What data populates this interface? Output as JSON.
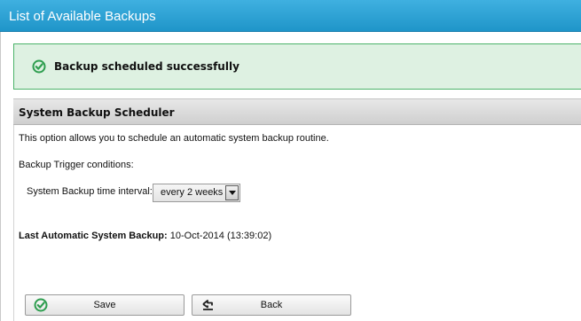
{
  "header": {
    "title": "List of Available Backups"
  },
  "alert": {
    "message": "Backup scheduled successfully",
    "icon": "check-circle-icon",
    "color": "#4cb36a"
  },
  "scheduler": {
    "title": "System Backup Scheduler",
    "description": "This option allows you to schedule an automatic system backup routine.",
    "trigger_label": "Backup Trigger conditions:",
    "interval_label": "System Backup time interval:",
    "interval_value": "every 2 weeks",
    "last_backup_label": "Last Automatic System Backup:",
    "last_backup_value": "10-Oct-2014 (13:39:02)"
  },
  "buttons": {
    "save_label": "Save",
    "save_icon": "check-circle-icon",
    "back_label": "Back",
    "back_icon": "back-arrow-icon"
  },
  "colors": {
    "header_blue": "#1f95c9",
    "success_bg": "#def1e2",
    "success_border": "#4cb36a"
  }
}
